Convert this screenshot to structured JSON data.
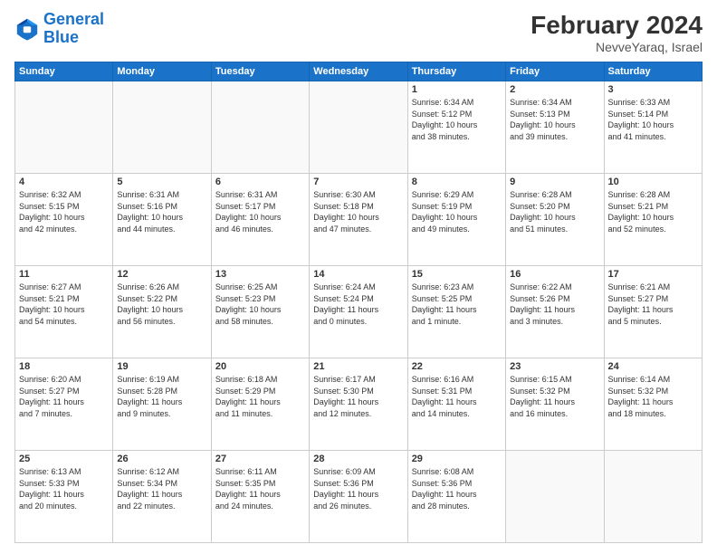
{
  "logo": {
    "line1": "General",
    "line2": "Blue"
  },
  "title": {
    "month_year": "February 2024",
    "location": "NevveYaraq, Israel"
  },
  "weekdays": [
    "Sunday",
    "Monday",
    "Tuesday",
    "Wednesday",
    "Thursday",
    "Friday",
    "Saturday"
  ],
  "weeks": [
    [
      {
        "day": "",
        "info": ""
      },
      {
        "day": "",
        "info": ""
      },
      {
        "day": "",
        "info": ""
      },
      {
        "day": "",
        "info": ""
      },
      {
        "day": "1",
        "info": "Sunrise: 6:34 AM\nSunset: 5:12 PM\nDaylight: 10 hours\nand 38 minutes."
      },
      {
        "day": "2",
        "info": "Sunrise: 6:34 AM\nSunset: 5:13 PM\nDaylight: 10 hours\nand 39 minutes."
      },
      {
        "day": "3",
        "info": "Sunrise: 6:33 AM\nSunset: 5:14 PM\nDaylight: 10 hours\nand 41 minutes."
      }
    ],
    [
      {
        "day": "4",
        "info": "Sunrise: 6:32 AM\nSunset: 5:15 PM\nDaylight: 10 hours\nand 42 minutes."
      },
      {
        "day": "5",
        "info": "Sunrise: 6:31 AM\nSunset: 5:16 PM\nDaylight: 10 hours\nand 44 minutes."
      },
      {
        "day": "6",
        "info": "Sunrise: 6:31 AM\nSunset: 5:17 PM\nDaylight: 10 hours\nand 46 minutes."
      },
      {
        "day": "7",
        "info": "Sunrise: 6:30 AM\nSunset: 5:18 PM\nDaylight: 10 hours\nand 47 minutes."
      },
      {
        "day": "8",
        "info": "Sunrise: 6:29 AM\nSunset: 5:19 PM\nDaylight: 10 hours\nand 49 minutes."
      },
      {
        "day": "9",
        "info": "Sunrise: 6:28 AM\nSunset: 5:20 PM\nDaylight: 10 hours\nand 51 minutes."
      },
      {
        "day": "10",
        "info": "Sunrise: 6:28 AM\nSunset: 5:21 PM\nDaylight: 10 hours\nand 52 minutes."
      }
    ],
    [
      {
        "day": "11",
        "info": "Sunrise: 6:27 AM\nSunset: 5:21 PM\nDaylight: 10 hours\nand 54 minutes."
      },
      {
        "day": "12",
        "info": "Sunrise: 6:26 AM\nSunset: 5:22 PM\nDaylight: 10 hours\nand 56 minutes."
      },
      {
        "day": "13",
        "info": "Sunrise: 6:25 AM\nSunset: 5:23 PM\nDaylight: 10 hours\nand 58 minutes."
      },
      {
        "day": "14",
        "info": "Sunrise: 6:24 AM\nSunset: 5:24 PM\nDaylight: 11 hours\nand 0 minutes."
      },
      {
        "day": "15",
        "info": "Sunrise: 6:23 AM\nSunset: 5:25 PM\nDaylight: 11 hours\nand 1 minute."
      },
      {
        "day": "16",
        "info": "Sunrise: 6:22 AM\nSunset: 5:26 PM\nDaylight: 11 hours\nand 3 minutes."
      },
      {
        "day": "17",
        "info": "Sunrise: 6:21 AM\nSunset: 5:27 PM\nDaylight: 11 hours\nand 5 minutes."
      }
    ],
    [
      {
        "day": "18",
        "info": "Sunrise: 6:20 AM\nSunset: 5:27 PM\nDaylight: 11 hours\nand 7 minutes."
      },
      {
        "day": "19",
        "info": "Sunrise: 6:19 AM\nSunset: 5:28 PM\nDaylight: 11 hours\nand 9 minutes."
      },
      {
        "day": "20",
        "info": "Sunrise: 6:18 AM\nSunset: 5:29 PM\nDaylight: 11 hours\nand 11 minutes."
      },
      {
        "day": "21",
        "info": "Sunrise: 6:17 AM\nSunset: 5:30 PM\nDaylight: 11 hours\nand 12 minutes."
      },
      {
        "day": "22",
        "info": "Sunrise: 6:16 AM\nSunset: 5:31 PM\nDaylight: 11 hours\nand 14 minutes."
      },
      {
        "day": "23",
        "info": "Sunrise: 6:15 AM\nSunset: 5:32 PM\nDaylight: 11 hours\nand 16 minutes."
      },
      {
        "day": "24",
        "info": "Sunrise: 6:14 AM\nSunset: 5:32 PM\nDaylight: 11 hours\nand 18 minutes."
      }
    ],
    [
      {
        "day": "25",
        "info": "Sunrise: 6:13 AM\nSunset: 5:33 PM\nDaylight: 11 hours\nand 20 minutes."
      },
      {
        "day": "26",
        "info": "Sunrise: 6:12 AM\nSunset: 5:34 PM\nDaylight: 11 hours\nand 22 minutes."
      },
      {
        "day": "27",
        "info": "Sunrise: 6:11 AM\nSunset: 5:35 PM\nDaylight: 11 hours\nand 24 minutes."
      },
      {
        "day": "28",
        "info": "Sunrise: 6:09 AM\nSunset: 5:36 PM\nDaylight: 11 hours\nand 26 minutes."
      },
      {
        "day": "29",
        "info": "Sunrise: 6:08 AM\nSunset: 5:36 PM\nDaylight: 11 hours\nand 28 minutes."
      },
      {
        "day": "",
        "info": ""
      },
      {
        "day": "",
        "info": ""
      }
    ]
  ]
}
